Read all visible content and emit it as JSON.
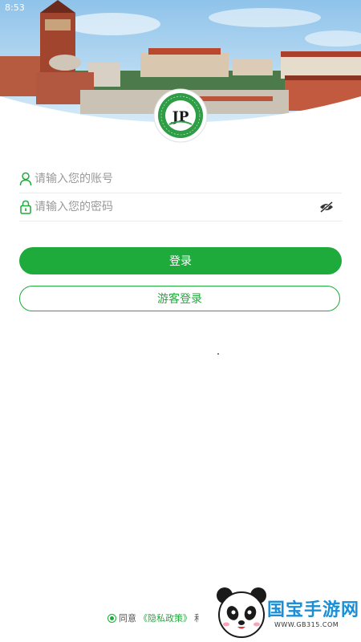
{
  "status_bar": {
    "time": "8:53"
  },
  "login": {
    "username_placeholder": "请输入您的账号",
    "password_placeholder": "请输入您的密码",
    "login_button": "登录",
    "guest_button": "游客登录"
  },
  "agreement": {
    "prefix": "同意",
    "privacy_link": "《隐私政策》",
    "conjunction": "和"
  },
  "watermark": {
    "title": "国宝手游网",
    "subtitle": "WWW.GB315.COM"
  },
  "colors": {
    "brand_green": "#1faa3c",
    "watermark_blue": "#1a8fd6"
  },
  "icons": [
    "user-icon",
    "lock-icon",
    "eye-off-icon",
    "panda-icon"
  ]
}
